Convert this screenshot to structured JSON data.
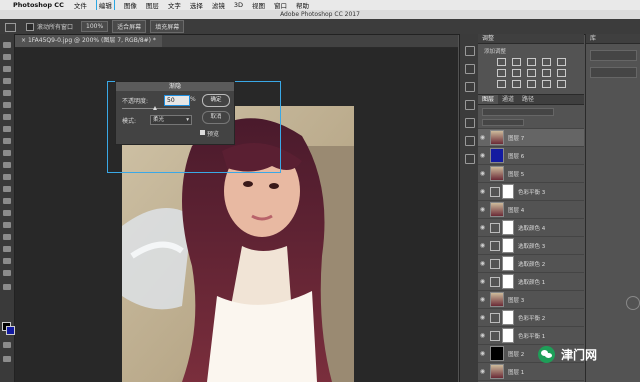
{
  "menubar": {
    "app": "Photoshop CC",
    "items": [
      "文件",
      "编辑",
      "图像",
      "图层",
      "文字",
      "选择",
      "滤镜",
      "3D",
      "视图",
      "窗口",
      "帮助"
    ],
    "active_index": 1
  },
  "window_title": "Adobe Photoshop CC 2017",
  "options_bar": {
    "scroll_all_label": "滚动所有窗口",
    "btn_100": "100%",
    "btn_fit": "适合屏幕",
    "btn_fill": "填充屏幕"
  },
  "document_tab": "1FA45Q9-0.jpg @ 200% (图层 7, RGB/8#) *",
  "fade_dialog": {
    "title": "渐隐",
    "opacity_label": "不透明度:",
    "opacity_value": "50",
    "percent": "%",
    "mode_label": "模式:",
    "mode_value": "柔光",
    "ok": "确定",
    "cancel": "取消",
    "preview": "预览"
  },
  "adjust_panel": {
    "tab": "调整",
    "subtitle": "添加调整"
  },
  "library_panel": {
    "tab": "库"
  },
  "layers_panel": {
    "tabs": [
      "图层",
      "通道",
      "路径"
    ],
    "rows": [
      {
        "name": "图层 7",
        "selected": true,
        "thumb": "photo"
      },
      {
        "name": "图层 6",
        "selected": false,
        "thumb": "navy"
      },
      {
        "name": "图层 5",
        "selected": false,
        "thumb": "photo"
      },
      {
        "name": "色彩平衡 3",
        "selected": false,
        "thumb": "adjust"
      },
      {
        "name": "图层 4",
        "selected": false,
        "thumb": "photo"
      },
      {
        "name": "选取颜色 4",
        "selected": false,
        "thumb": "adjust"
      },
      {
        "name": "选取颜色 3",
        "selected": false,
        "thumb": "adjust"
      },
      {
        "name": "选取颜色 2",
        "selected": false,
        "thumb": "adjust"
      },
      {
        "name": "选取颜色 1",
        "selected": false,
        "thumb": "adjust"
      },
      {
        "name": "图层 3",
        "selected": false,
        "thumb": "photo"
      },
      {
        "name": "色彩平衡 2",
        "selected": false,
        "thumb": "adjust"
      },
      {
        "name": "色彩平衡 1",
        "selected": false,
        "thumb": "adjust"
      },
      {
        "name": "图层 2",
        "selected": false,
        "thumb": "black"
      },
      {
        "name": "图层 1",
        "selected": false,
        "thumb": "photo"
      }
    ]
  },
  "watermark": {
    "text": "津门网"
  },
  "colors": {
    "accent": "#3aa8e6",
    "foreground": "#000000",
    "background": "#131ba0"
  }
}
